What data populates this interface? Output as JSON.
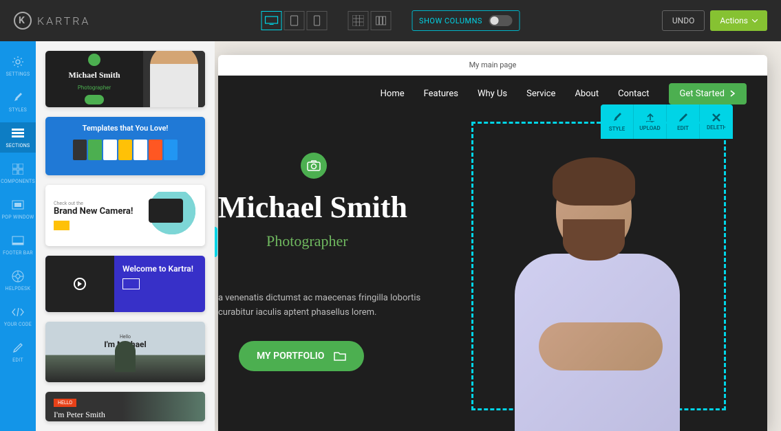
{
  "brand": {
    "name": "KARTRA",
    "mark": "K"
  },
  "topbar": {
    "show_columns_label": "SHOW COLUMNS",
    "undo_label": "UNDO",
    "actions_label": "Actions"
  },
  "left_rail": [
    {
      "label": "SETTINGS",
      "icon": "gear"
    },
    {
      "label": "STYLES",
      "icon": "brush"
    },
    {
      "label": "SECTIONS",
      "icon": "sections"
    },
    {
      "label": "COMPONENTS",
      "icon": "components"
    },
    {
      "label": "POP WINDOW",
      "icon": "popup"
    },
    {
      "label": "FOOTER BAR",
      "icon": "footer"
    },
    {
      "label": "HELPDESK",
      "icon": "lifebuoy"
    },
    {
      "label": "YOUR CODE",
      "icon": "code"
    },
    {
      "label": "EDIT",
      "icon": "pencil"
    }
  ],
  "templates": [
    {
      "name": "Michael Smith",
      "subtitle": "Photographer",
      "button": ""
    },
    {
      "title": "Templates that You Love!"
    },
    {
      "subtitle": "Check out the",
      "title": "Brand New Camera!",
      "button": ""
    },
    {
      "title": "Welcome to Kartra!",
      "button": ""
    },
    {
      "subtitle": "Hello",
      "title": "I'm Michael"
    },
    {
      "badge": "HELLO",
      "title": "I'm Peter Smith"
    }
  ],
  "page": {
    "title": "My main page",
    "nav": [
      "Home",
      "Features",
      "Why Us",
      "Service",
      "About",
      "Contact"
    ],
    "cta": "Get Started",
    "hero": {
      "name": "Michael Smith",
      "subtitle": "Photographer",
      "description": "a venenatis dictumst ac maecenas fringilla lobortis curabitur iaculis aptent phasellus lorem.",
      "button": "MY PORTFOLIO"
    }
  },
  "edit_toolbar": [
    {
      "label": "STYLE",
      "icon": "brush"
    },
    {
      "label": "UPLOAD",
      "icon": "upload"
    },
    {
      "label": "EDIT",
      "icon": "pencil"
    },
    {
      "label": "DELETE",
      "icon": "close"
    }
  ]
}
